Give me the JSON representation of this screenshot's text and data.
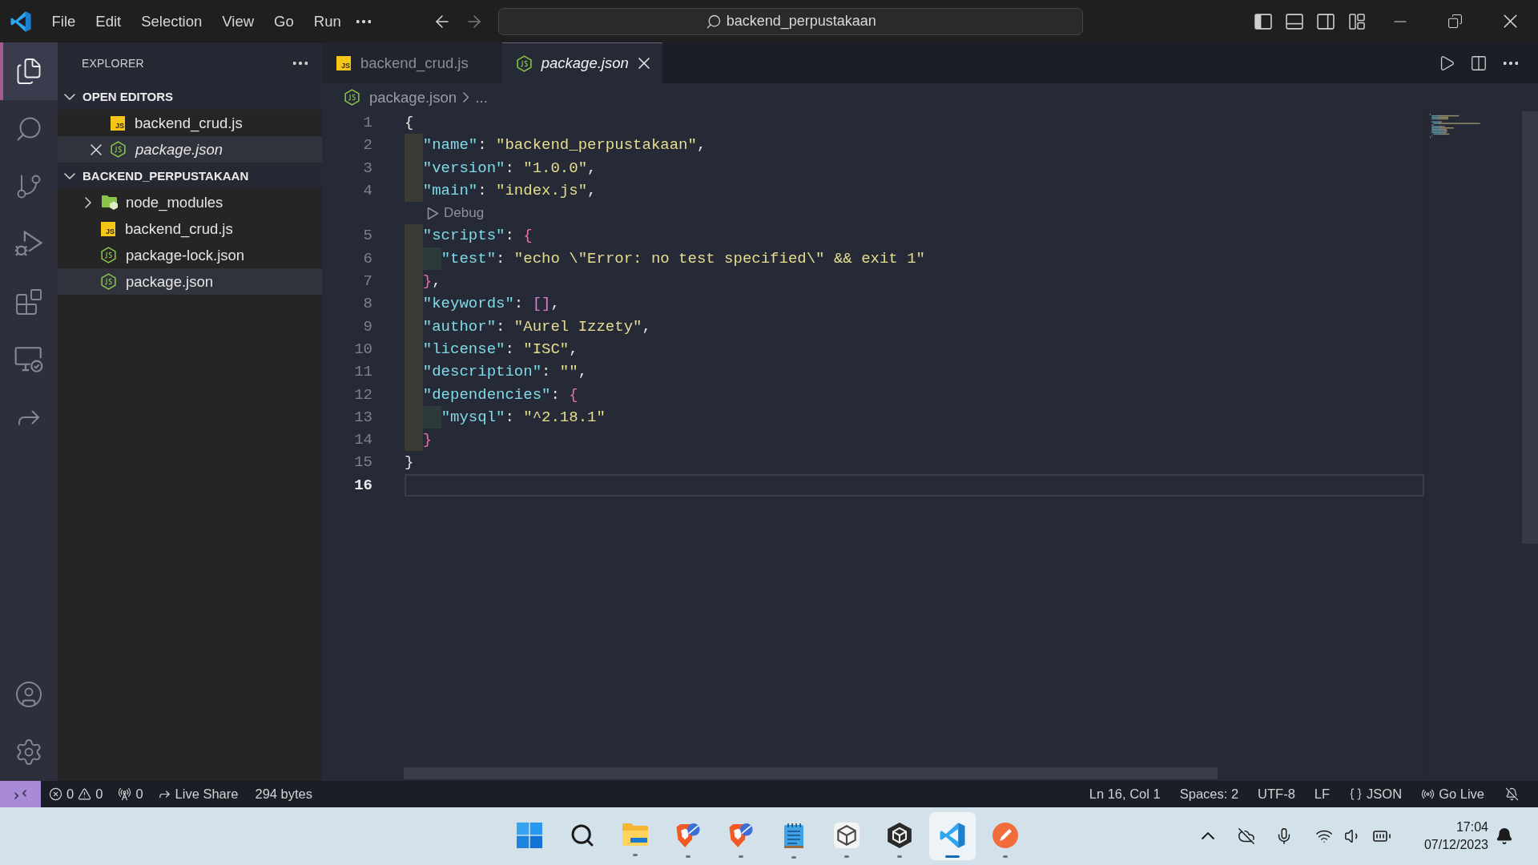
{
  "title_bar": {
    "menu": [
      "File",
      "Edit",
      "Selection",
      "View",
      "Go",
      "Run"
    ],
    "search": {
      "value": "backend_perpustakaan"
    },
    "layout_toggles": [
      {
        "kind": "sidebar",
        "on": true
      },
      {
        "kind": "panel",
        "on": false
      },
      {
        "kind": "secondary",
        "on": false
      }
    ]
  },
  "activity_bar": {
    "items": [
      {
        "kind": "explorer",
        "selected": true
      },
      {
        "kind": "search",
        "selected": false
      },
      {
        "kind": "scm",
        "selected": false
      },
      {
        "kind": "debug",
        "selected": false
      },
      {
        "kind": "extensions",
        "selected": false
      },
      {
        "kind": "remote",
        "selected": false
      },
      {
        "kind": "share",
        "selected": false
      }
    ],
    "bottom": [
      {
        "kind": "account"
      },
      {
        "kind": "settings"
      }
    ]
  },
  "sidebar": {
    "title": "EXPLORER",
    "sections": [
      {
        "kind": "editors",
        "title": "OPEN EDITORS",
        "expanded": true,
        "items": [
          {
            "kind": "js",
            "icon_text": "JS",
            "label": "backend_crud.js",
            "selected": false,
            "preview": false
          },
          {
            "kind": "json",
            "label": "package.json",
            "selected": true,
            "preview": true
          }
        ]
      },
      {
        "kind": "folder",
        "title": "BACKEND_PERPUSTAKAAN",
        "expanded": true,
        "items": [
          {
            "kind": "folder",
            "label": "node_modules",
            "expanded": false,
            "selected": false
          },
          {
            "kind": "js",
            "icon_text": "JS",
            "label": "backend_crud.js",
            "selected": false
          },
          {
            "kind": "json",
            "label": "package-lock.json",
            "selected": false
          },
          {
            "kind": "json",
            "label": "package.json",
            "selected": true
          }
        ]
      }
    ]
  },
  "editor": {
    "tabs": [
      {
        "kind": "js",
        "icon_text": "JS",
        "label": "backend_crud.js",
        "selected": false,
        "preview": false
      },
      {
        "kind": "json",
        "label": "package.json",
        "selected": true,
        "preview": true
      }
    ],
    "breadcrumb": [
      {
        "kind": "json",
        "label": "package.json"
      },
      {
        "kind": "more",
        "label": "..."
      }
    ],
    "lines": [
      {
        "kind": "code",
        "number": "1",
        "current": false,
        "tokens": [
          {
            "kind": "punct",
            "text": "{"
          }
        ]
      },
      {
        "kind": "code",
        "number": "2",
        "current": false,
        "tokens": [
          {
            "kind": "key",
            "text": "  \"name\""
          },
          {
            "kind": "punct",
            "text": ": "
          },
          {
            "kind": "string",
            "text": "\"backend_perpustakaan\""
          },
          {
            "kind": "punct",
            "text": ","
          }
        ]
      },
      {
        "kind": "code",
        "number": "3",
        "current": false,
        "tokens": [
          {
            "kind": "key",
            "text": "  \"version\""
          },
          {
            "kind": "punct",
            "text": ": "
          },
          {
            "kind": "string",
            "text": "\"1.0.0\""
          },
          {
            "kind": "punct",
            "text": ","
          }
        ]
      },
      {
        "kind": "code",
        "number": "4",
        "current": false,
        "tokens": [
          {
            "kind": "key",
            "text": "  \"main\""
          },
          {
            "kind": "punct",
            "text": ": "
          },
          {
            "kind": "string",
            "text": "\"index.js\""
          },
          {
            "kind": "punct",
            "text": ","
          }
        ]
      },
      {
        "kind": "codelens",
        "text": "Debug"
      },
      {
        "kind": "code",
        "number": "5",
        "current": false,
        "tokens": [
          {
            "kind": "key",
            "text": "  \"scripts\""
          },
          {
            "kind": "punct",
            "text": ": "
          },
          {
            "kind": "bracket",
            "text": "{"
          }
        ]
      },
      {
        "kind": "code",
        "number": "6",
        "current": false,
        "tokens": [
          {
            "kind": "key",
            "text": "    \"test\""
          },
          {
            "kind": "punct",
            "text": ": "
          },
          {
            "kind": "string",
            "text": "\"echo \\\"Error: no test specified\\\" && exit 1\""
          }
        ]
      },
      {
        "kind": "code",
        "number": "7",
        "current": false,
        "tokens": [
          {
            "kind": "bracket",
            "text": "  }"
          },
          {
            "kind": "punct",
            "text": ","
          }
        ]
      },
      {
        "kind": "code",
        "number": "8",
        "current": false,
        "tokens": [
          {
            "kind": "key",
            "text": "  \"keywords\""
          },
          {
            "kind": "punct",
            "text": ": "
          },
          {
            "kind": "array",
            "text": "[]"
          },
          {
            "kind": "punct",
            "text": ","
          }
        ]
      },
      {
        "kind": "code",
        "number": "9",
        "current": false,
        "tokens": [
          {
            "kind": "key",
            "text": "  \"author\""
          },
          {
            "kind": "punct",
            "text": ": "
          },
          {
            "kind": "string",
            "text": "\"Aurel Izzety\""
          },
          {
            "kind": "punct",
            "text": ","
          }
        ]
      },
      {
        "kind": "code",
        "number": "10",
        "current": false,
        "tokens": [
          {
            "kind": "key",
            "text": "  \"license\""
          },
          {
            "kind": "punct",
            "text": ": "
          },
          {
            "kind": "string",
            "text": "\"ISC\""
          },
          {
            "kind": "punct",
            "text": ","
          }
        ]
      },
      {
        "kind": "code",
        "number": "11",
        "current": false,
        "tokens": [
          {
            "kind": "key",
            "text": "  \"description\""
          },
          {
            "kind": "punct",
            "text": ": "
          },
          {
            "kind": "string",
            "text": "\"\""
          },
          {
            "kind": "punct",
            "text": ","
          }
        ]
      },
      {
        "kind": "code",
        "number": "12",
        "current": false,
        "tokens": [
          {
            "kind": "key",
            "text": "  \"dependencies\""
          },
          {
            "kind": "punct",
            "text": ": "
          },
          {
            "kind": "bracket",
            "text": "{"
          }
        ]
      },
      {
        "kind": "code",
        "number": "13",
        "current": false,
        "tokens": [
          {
            "kind": "key",
            "text": "    \"mysql\""
          },
          {
            "kind": "punct",
            "text": ": "
          },
          {
            "kind": "string",
            "text": "\"^2.18.1\""
          }
        ]
      },
      {
        "kind": "code",
        "number": "14",
        "current": false,
        "tokens": [
          {
            "kind": "bracket",
            "text": "  }"
          }
        ]
      },
      {
        "kind": "code",
        "number": "15",
        "current": false,
        "tokens": [
          {
            "kind": "punct",
            "text": "}"
          }
        ]
      },
      {
        "kind": "code",
        "number": "16",
        "current": true
      }
    ]
  },
  "status_bar": {
    "left": [
      {
        "kind": "remote"
      },
      {
        "kind": "problems",
        "errors": "0",
        "warnings": "0"
      },
      {
        "kind": "ports",
        "text": "0"
      },
      {
        "kind": "share",
        "text": "Live Share"
      },
      {
        "kind": "text",
        "text": "294 bytes"
      }
    ],
    "right": [
      {
        "kind": "text",
        "text": "Ln 16, Col 1"
      },
      {
        "kind": "text",
        "text": "Spaces: 2"
      },
      {
        "kind": "text",
        "text": "UTF-8"
      },
      {
        "kind": "text",
        "text": "LF"
      },
      {
        "kind": "language",
        "text": "JSON"
      },
      {
        "kind": "golive",
        "text": "Go Live"
      },
      {
        "kind": "notifications"
      }
    ]
  },
  "taskbar": {
    "apps": [
      {
        "kind": "start",
        "running": false,
        "selected": false
      },
      {
        "kind": "search",
        "running": false,
        "selected": false
      },
      {
        "kind": "files",
        "running": true,
        "selected": false
      },
      {
        "kind": "browser",
        "running": true,
        "selected": false
      },
      {
        "kind": "browser",
        "running": true,
        "selected": false
      },
      {
        "kind": "notepad",
        "running": true,
        "selected": false
      },
      {
        "kind": "hub",
        "running": true,
        "selected": false
      },
      {
        "kind": "engine",
        "running": true,
        "selected": false
      },
      {
        "kind": "editor",
        "running": true,
        "selected": true
      },
      {
        "kind": "api",
        "running": true,
        "selected": false
      }
    ],
    "tray": [
      {
        "kind": "chevron"
      },
      {
        "kind": "cloud"
      },
      {
        "kind": "mic"
      },
      {
        "kind": "wifi"
      },
      {
        "kind": "volume"
      },
      {
        "kind": "battery"
      }
    ],
    "clock": {
      "time": "17:04",
      "date": "07/12/2023"
    }
  }
}
